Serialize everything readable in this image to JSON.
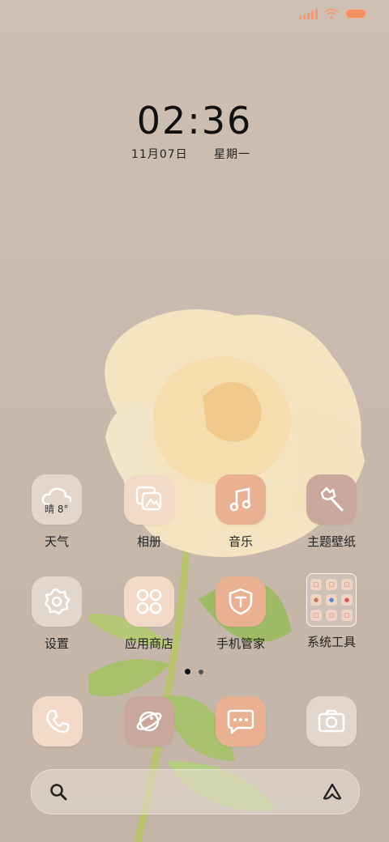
{
  "status": {
    "signal_icon": "signal-icon",
    "wifi_icon": "wifi-icon",
    "battery_icon": "battery-icon"
  },
  "clock": {
    "time": "02:36",
    "date": "11月07日",
    "weekday": "星期一"
  },
  "weather": {
    "condition": "晴",
    "temperature": "8°"
  },
  "apps_row1": [
    {
      "label": "天气",
      "icon": "weather-icon"
    },
    {
      "label": "相册",
      "icon": "gallery-icon"
    },
    {
      "label": "音乐",
      "icon": "music-icon"
    },
    {
      "label": "主题壁纸",
      "icon": "theme-icon"
    }
  ],
  "apps_row2": [
    {
      "label": "设置",
      "icon": "settings-icon"
    },
    {
      "label": "应用商店",
      "icon": "app-store-icon"
    },
    {
      "label": "手机管家",
      "icon": "phone-manager-icon"
    },
    {
      "label": "系统工具",
      "icon": "folder-icon"
    }
  ],
  "dock": [
    {
      "icon": "phone-icon"
    },
    {
      "icon": "browser-icon"
    },
    {
      "icon": "messages-icon"
    },
    {
      "icon": "camera-icon"
    }
  ],
  "page_indicator": {
    "pages": 2,
    "current": 1
  },
  "search": {
    "search_icon": "search-icon",
    "assistant_icon": "assistant-icon"
  },
  "colors": {
    "accent": "#e9b092",
    "signal": "#f29b72",
    "battery": "#f28f63"
  }
}
